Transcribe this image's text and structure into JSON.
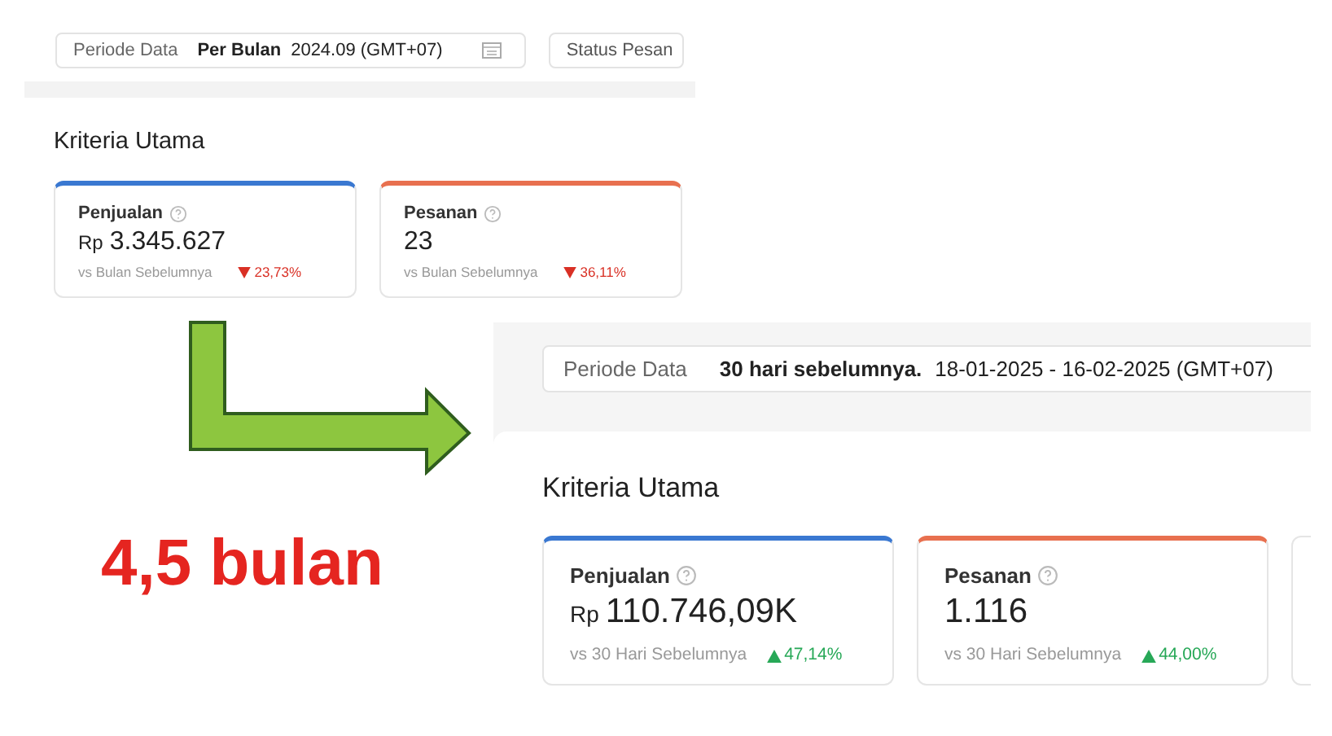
{
  "panels": [
    {
      "filter": {
        "label": "Periode Data",
        "mode": "Per Bulan",
        "value": "2024.09 (GMT+07)",
        "calendar": true
      },
      "status_filter": "Status Pesan",
      "heading": "Kriteria Utama",
      "cards": [
        {
          "title": "Penjualan",
          "currency": "Rp",
          "value": "3.345.627",
          "comparison": "vs Bulan Sebelumnya",
          "change": "23,73%",
          "kind": "down",
          "color": "#3a78d1"
        },
        {
          "title": "Pesanan",
          "value": "23",
          "comparison": "vs Bulan Sebelumnya",
          "change": "36,11%",
          "kind": "down",
          "color": "#e8704f"
        }
      ]
    },
    {
      "filter": {
        "label": "Periode Data",
        "mode": "30 hari sebelumnya.",
        "value": "18-01-2025 - 16-02-2025 (GMT+07)"
      },
      "heading": "Kriteria Utama",
      "overflow_card": true,
      "cards": [
        {
          "title": "Penjualan",
          "currency": "Rp",
          "value": "110.746,09K",
          "comparison": "vs 30 Hari Sebelumnya",
          "change": "47,14%",
          "kind": "up",
          "color": "#3a78d1"
        },
        {
          "title": "Pesanan",
          "value": "1.116",
          "comparison": "vs 30 Hari Sebelumnya",
          "change": "44,00%",
          "kind": "up",
          "color": "#e8704f"
        }
      ]
    }
  ],
  "caption": "4,5 bulan"
}
